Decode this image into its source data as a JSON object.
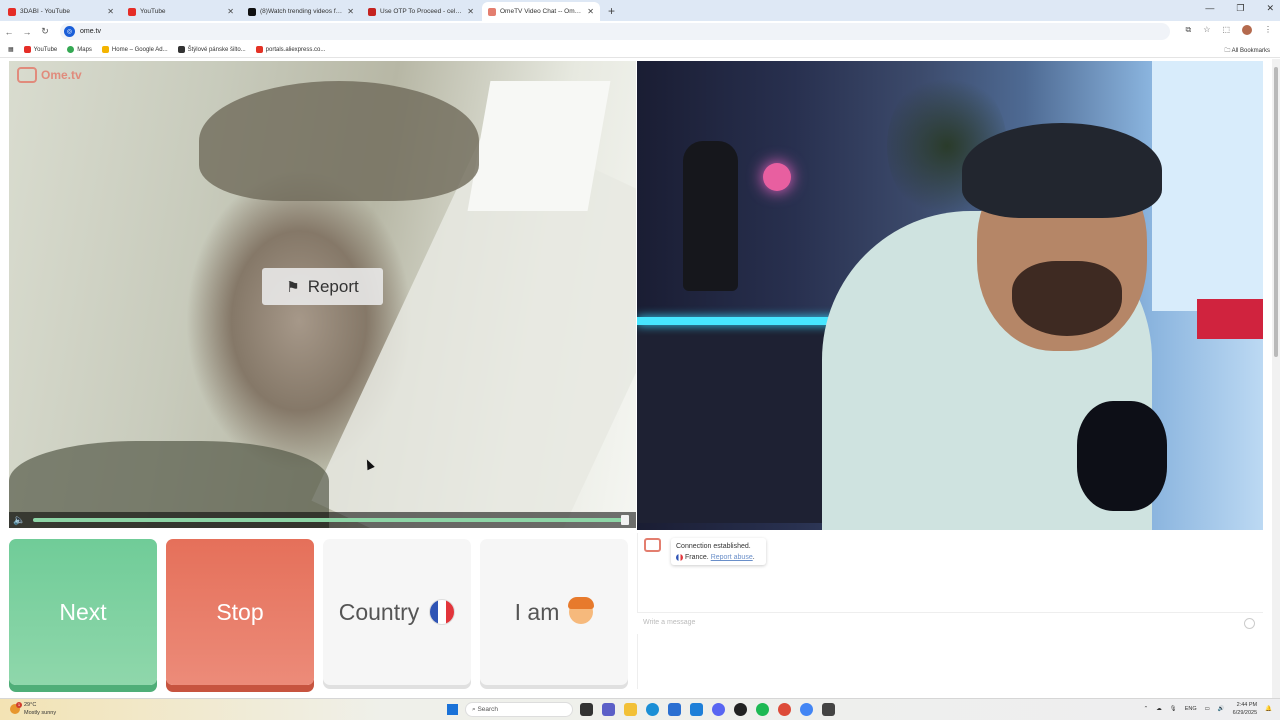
{
  "browser": {
    "tabs": [
      {
        "title": "3DABI - YouTube",
        "icon": "youtube-icon",
        "color": "#e52d27",
        "active": false
      },
      {
        "title": "YouTube",
        "icon": "youtube-icon",
        "color": "#e52d27",
        "active": false
      },
      {
        "title": "(8)Watch trending videos for y...",
        "icon": "tiktok-icon",
        "color": "#111111",
        "active": false
      },
      {
        "title": "Use OTP To Proceed - celtisan...",
        "icon": "gmail-icon",
        "color": "#c5221f",
        "active": false
      },
      {
        "title": "OmeTV Video Chat -- Ome...",
        "icon": "ometv-icon",
        "color": "#e37e6f",
        "active": true
      }
    ],
    "url": "ome.tv",
    "bookmarks": [
      {
        "label": "YouTube",
        "color": "#e52d27"
      },
      {
        "label": "Maps",
        "color": "#34a853"
      },
      {
        "label": "Home – Google Ad...",
        "color": "#f4b400"
      },
      {
        "label": "Štýlové pánske šiltо...",
        "color": "#333333"
      },
      {
        "label": "portals.aliexpress.co...",
        "color": "#e43225"
      }
    ],
    "all_bookmarks": "All Bookmarks"
  },
  "video": {
    "logo_text": "Ome.tv",
    "report_label": "Report",
    "volume_level": 0.99
  },
  "controls": {
    "next_label": "Next",
    "stop_label": "Stop",
    "country_label": "Country",
    "iam_label": "I am"
  },
  "chat": {
    "status": "Connection established.",
    "country": "France.",
    "report_link": "Report abuse",
    "input_placeholder": "Write a message"
  },
  "taskbar": {
    "temperature": "29°C",
    "weather": "Mostly sunny",
    "notification_count": "1",
    "search_placeholder": "Search",
    "language": "ENG",
    "time": "2:44 PM",
    "date": "6/29/2025"
  },
  "colors": {
    "next": "#70cc98",
    "stop": "#e5705a",
    "brand": "#e37e6f"
  }
}
